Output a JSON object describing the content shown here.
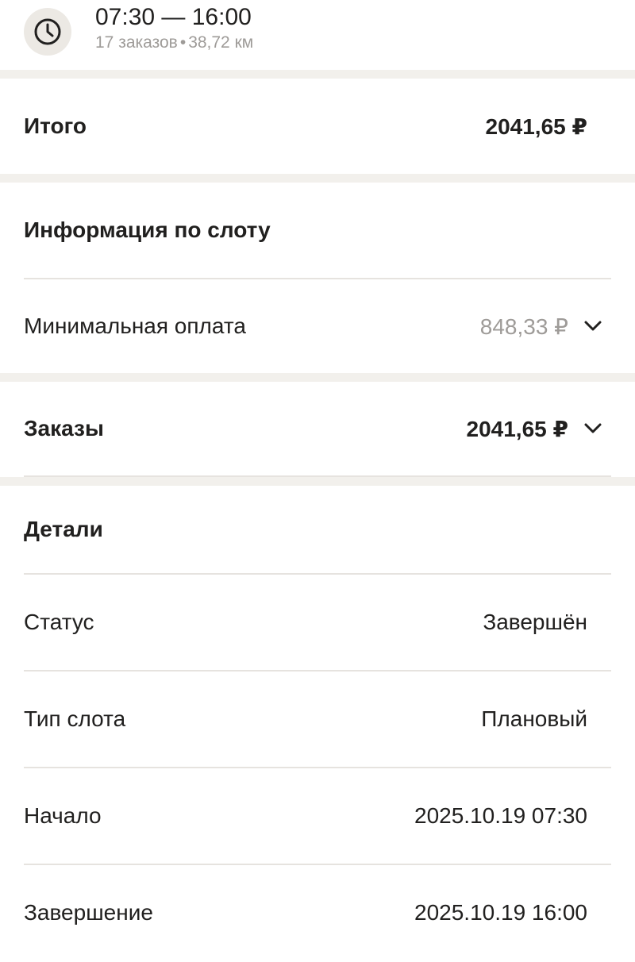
{
  "header": {
    "icon": "clock-icon",
    "time_range": "07:30 — 16:00",
    "orders_count": "17 заказов",
    "separator": "•",
    "distance": "38,72 км"
  },
  "total": {
    "label": "Итого",
    "value": "2041,65 ₽"
  },
  "slot_info": {
    "title": "Информация по слоту",
    "min_pay_label": "Минимальная оплата",
    "min_pay_value": "848,33 ₽",
    "expand_icon": "chevron-down-icon"
  },
  "orders": {
    "label": "Заказы",
    "value": "2041,65 ₽",
    "expand_icon": "chevron-down-icon"
  },
  "details": {
    "title": "Детали",
    "rows": [
      {
        "label": "Статус",
        "value": "Завершён"
      },
      {
        "label": "Тип слота",
        "value": "Плановый"
      },
      {
        "label": "Начало",
        "value": "2025.10.19 07:30"
      },
      {
        "label": "Завершение",
        "value": "2025.10.19 16:00"
      }
    ]
  },
  "colors": {
    "text": "#21201f",
    "muted": "#9e9b98",
    "background": "#f2f0ec",
    "divider": "#e6e3df"
  }
}
